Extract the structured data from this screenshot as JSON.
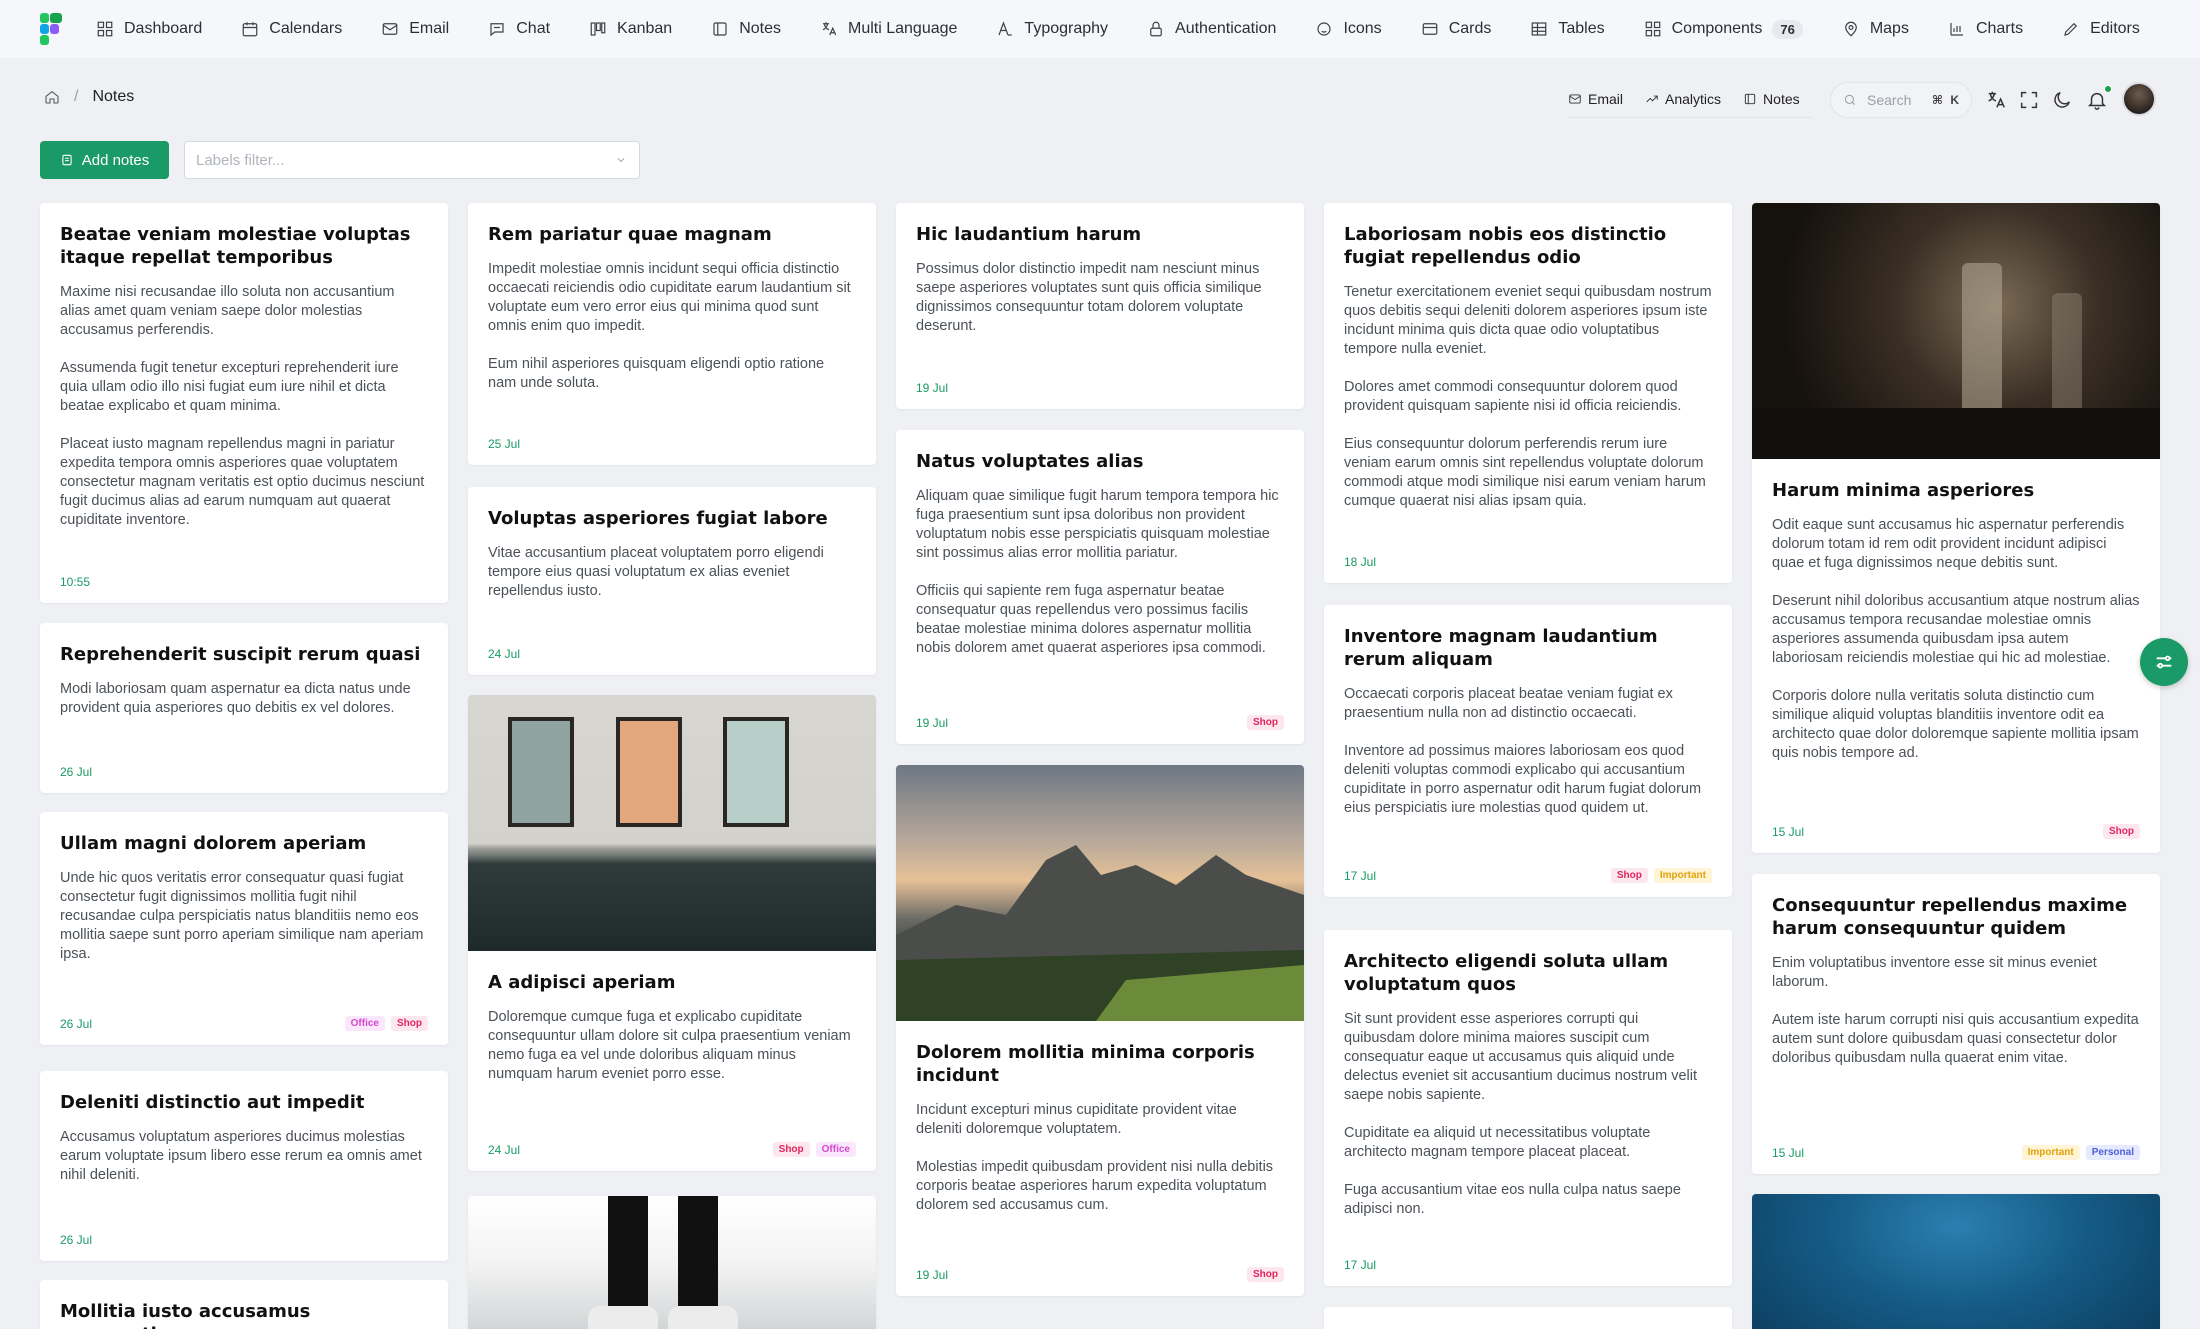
{
  "nav": {
    "items": [
      {
        "label": "Dashboard",
        "icon": "dashboard-icon"
      },
      {
        "label": "Calendars",
        "icon": "calendar-icon"
      },
      {
        "label": "Email",
        "icon": "mail-icon"
      },
      {
        "label": "Chat",
        "icon": "chat-icon"
      },
      {
        "label": "Kanban",
        "icon": "kanban-icon"
      },
      {
        "label": "Notes",
        "icon": "notes-icon"
      },
      {
        "label": "Multi Language",
        "icon": "translate-icon"
      },
      {
        "label": "Typography",
        "icon": "typography-icon"
      },
      {
        "label": "Authentication",
        "icon": "lock-icon"
      },
      {
        "label": "Icons",
        "icon": "icons-icon"
      },
      {
        "label": "Cards",
        "icon": "cards-icon"
      },
      {
        "label": "Tables",
        "icon": "table-icon"
      },
      {
        "label": "Components",
        "icon": "components-icon",
        "badge": "76"
      },
      {
        "label": "Maps",
        "icon": "map-icon"
      },
      {
        "label": "Charts",
        "icon": "chart-icon"
      },
      {
        "label": "Editors",
        "icon": "pen-icon"
      }
    ]
  },
  "breadcrumb": {
    "current": "Notes",
    "separator": "/"
  },
  "quick_links": [
    {
      "label": "Email",
      "icon": "mail-icon"
    },
    {
      "label": "Analytics",
      "icon": "analytics-icon"
    },
    {
      "label": "Notes",
      "icon": "notes-icon"
    }
  ],
  "search": {
    "placeholder": "Search",
    "shortcut": "⌘ K"
  },
  "toolbar": {
    "add_label": "Add notes",
    "labels_placeholder": "Labels filter..."
  },
  "colors": {
    "accent": "#1a9a66"
  },
  "notes": {
    "n1": {
      "title": "Beatae veniam molestiae voluptas itaque repellat temporibus",
      "paragraphs": [
        "Maxime nisi recusandae illo soluta non accusantium alias amet quam veniam saepe dolor molestias accusamus perferendis.",
        "Assumenda fugit tenetur excepturi reprehenderit iure quia ullam odio illo nisi fugiat eum iure nihil et dicta beatae explicabo et quam minima.",
        "Placeat iusto magnam repellendus magni in pariatur expedita tempora omnis asperiores quae voluptatem consectetur magnam veritatis est optio ducimus nesciunt fugit ducimus alias ad earum numquam aut quaerat cupiditate inventore."
      ],
      "date": "10:55",
      "tags": []
    },
    "n2": {
      "title": "Reprehenderit suscipit rerum quasi",
      "paragraphs": [
        "Modi laboriosam quam aspernatur ea dicta natus unde provident quia asperiores quo debitis ex vel dolores."
      ],
      "date": "26 Jul",
      "tags": []
    },
    "n3": {
      "title": "Ullam magni dolorem aperiam",
      "paragraphs": [
        "Unde hic quos veritatis error consequatur quasi fugiat consectetur fugit dignissimos mollitia fugit nihil recusandae culpa perspiciatis natus blanditiis nemo eos mollitia saepe sunt porro aperiam similique nam aperiam ipsa."
      ],
      "date": "26 Jul",
      "tags": [
        "Office",
        "Shop"
      ]
    },
    "n4": {
      "title": "Deleniti distinctio aut impedit",
      "paragraphs": [
        "Accusamus voluptatum asperiores ducimus molestias earum voluptate ipsum libero esse rerum ea omnis amet nihil deleniti."
      ],
      "date": "26 Jul",
      "tags": []
    },
    "n5": {
      "title": "Mollitia iusto accusamus accusantium",
      "paragraphs": [],
      "date": "",
      "tags": []
    },
    "n6": {
      "title": "Rem pariatur quae magnam",
      "paragraphs": [
        "Impedit molestiae omnis incidunt sequi officia distinctio occaecati reiciendis odio cupiditate earum laudantium sit voluptate eum vero error eius qui minima quod sunt omnis enim quo impedit.",
        "Eum nihil asperiores quisquam eligendi optio ratione nam unde soluta."
      ],
      "date": "25 Jul",
      "tags": []
    },
    "n7": {
      "title": "Voluptas asperiores fugiat labore",
      "paragraphs": [
        "Vitae accusantium placeat voluptatem porro eligendi tempore eius quasi voluptatum ex alias eveniet repellendus iusto."
      ],
      "date": "24 Jul",
      "tags": []
    },
    "n8": {
      "title": "A adipisci aperiam",
      "paragraphs": [
        "Doloremque cumque fuga et explicabo cupiditate consequuntur ullam dolore sit culpa praesentium veniam nemo fuga ea vel unde doloribus aliquam minus numquam harum eveniet porro esse."
      ],
      "date": "24 Jul",
      "tags": [
        "Shop",
        "Office"
      ]
    },
    "n9": {
      "title": "Hic laudantium harum",
      "paragraphs": [
        "Possimus dolor distinctio impedit nam nesciunt minus saepe asperiores voluptates sunt quis officia similique dignissimos consequuntur totam dolorem voluptate deserunt."
      ],
      "date": "19 Jul",
      "tags": []
    },
    "n10": {
      "title": "Natus voluptates alias",
      "paragraphs": [
        "Aliquam quae similique fugit harum tempora tempora hic fuga praesentium sunt ipsa doloribus non provident voluptatum nobis esse perspiciatis quisquam molestiae sint possimus alias error mollitia pariatur.",
        "Officiis qui sapiente rem fuga aspernatur beatae consequatur quas repellendus vero possimus facilis beatae molestiae minima dolores aspernatur mollitia nobis dolorem amet quaerat asperiores ipsa commodi."
      ],
      "date": "19 Jul",
      "tags": [
        "Shop"
      ]
    },
    "n11": {
      "title": "Dolorem mollitia minima corporis incidunt",
      "paragraphs": [
        "Incidunt excepturi minus cupiditate provident vitae deleniti doloremque voluptatem.",
        "Molestias impedit quibusdam provident nisi nulla debitis corporis beatae asperiores harum expedita voluptatum dolorem sed accusamus cum."
      ],
      "date": "19 Jul",
      "tags": [
        "Shop"
      ]
    },
    "n12": {
      "title": "Laboriosam nobis eos distinctio fugiat repellendus odio",
      "paragraphs": [
        "Tenetur exercitationem eveniet sequi quibusdam nostrum quos debitis sequi deleniti dolorem asperiores ipsum iste incidunt minima quis dicta quae odio voluptatibus tempore nulla eveniet.",
        "Dolores amet commodi consequuntur dolorem quod provident quisquam sapiente nisi id officia reiciendis.",
        "Eius consequuntur dolorum perferendis rerum iure veniam earum omnis sint repellendus voluptate dolorum commodi atque modi similique nisi earum veniam harum cumque quaerat nisi alias ipsam quia."
      ],
      "date": "18 Jul",
      "tags": []
    },
    "n13": {
      "title": "Inventore magnam laudantium rerum aliquam",
      "paragraphs": [
        "Occaecati corporis placeat beatae veniam fugiat ex praesentium nulla non ad distinctio occaecati.",
        "Inventore ad possimus maiores laboriosam eos quod deleniti voluptas commodi explicabo qui accusantium cupiditate in porro aspernatur odit harum fugiat dolorum eius perspiciatis iure molestias quod quidem ut."
      ],
      "date": "17 Jul",
      "tags": [
        "Shop",
        "Important"
      ]
    },
    "n14": {
      "title": "Architecto eligendi soluta ullam voluptatum quos",
      "paragraphs": [
        "Sit sunt provident esse asperiores corrupti qui quibusdam dolore minima maiores suscipit cum consequatur eaque ut accusamus quis aliquid unde delectus eveniet sit accusantium ducimus nostrum velit saepe nobis sapiente.",
        "Cupiditate ea aliquid ut necessitatibus voluptate architecto magnam tempore placeat placeat.",
        "Fuga accusantium vitae eos nulla culpa natus saepe adipisci non."
      ],
      "date": "17 Jul",
      "tags": []
    },
    "n15": {
      "title": "Harum minima asperiores",
      "paragraphs": [
        "Odit eaque sunt accusamus hic aspernatur perferendis dolorum totam id rem odit provident incidunt adipisci quae et fuga dignissimos neque debitis sunt.",
        "Deserunt nihil doloribus accusantium atque nostrum alias accusamus tempora recusandae molestiae omnis asperiores assumenda quibusdam ipsa autem laboriosam reiciendis molestiae qui hic ad molestiae.",
        "Corporis dolore nulla veritatis soluta distinctio cum similique aliquid voluptas blanditiis inventore odit ea architecto quae dolor doloremque sapiente mollitia ipsam quis nobis tempore ad."
      ],
      "date": "15 Jul",
      "tags": [
        "Shop"
      ]
    },
    "n16": {
      "title": "Consequuntur repellendus maxime harum consequuntur quidem",
      "paragraphs": [
        "Enim voluptatibus inventore esse sit minus eveniet laborum.",
        "Autem iste harum corrupti nisi quis accusantium expedita autem sunt dolore quibusdam quasi consectetur dolor doloribus quibusdam nulla quaerat enim vitae."
      ],
      "date": "15 Jul",
      "tags": [
        "Important",
        "Personal"
      ]
    }
  }
}
